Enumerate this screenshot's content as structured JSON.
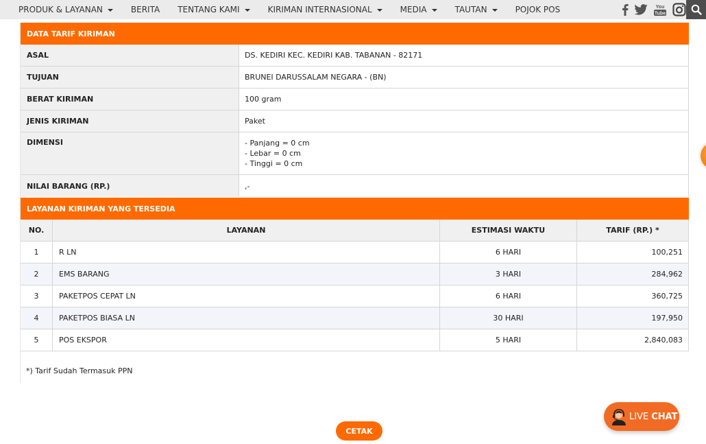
{
  "nav": {
    "items": [
      {
        "label": "PRODUK & LAYANAN",
        "dropdown": true
      },
      {
        "label": "BERITA",
        "dropdown": false
      },
      {
        "label": "TENTANG KAMI",
        "dropdown": true
      },
      {
        "label": "KIRIMAN INTERNASIONAL",
        "dropdown": true
      },
      {
        "label": "MEDIA",
        "dropdown": true
      },
      {
        "label": "TAUTAN",
        "dropdown": true
      },
      {
        "label": "POJOK POS",
        "dropdown": false
      }
    ],
    "social_icons": [
      "facebook-icon",
      "twitter-icon",
      "youtube-icon",
      "instagram-icon"
    ],
    "search_icon": "search-icon"
  },
  "tarif": {
    "title": "DATA TARIF KIRIMAN",
    "rows": {
      "asal": {
        "label": "ASAL",
        "value": "DS. KEDIRI KEC. KEDIRI KAB. TABANAN - 82171"
      },
      "tujuan": {
        "label": "TUJUAN",
        "value": "BRUNEI DARUSSALAM NEGARA - (BN)"
      },
      "berat": {
        "label": "BERAT KIRIMAN",
        "value": "100 gram"
      },
      "jenis": {
        "label": "JENIS KIRIMAN",
        "value": "Paket"
      },
      "dimensi": {
        "label": "DIMENSI",
        "lines": [
          "- Panjang = 0 cm",
          "- Lebar = 0 cm",
          "- Tinggi = 0 cm"
        ]
      },
      "nilai": {
        "label": "NILAI BARANG (RP.)",
        "value": ",-"
      }
    }
  },
  "layanan": {
    "title": "LAYANAN KIRIMAN YANG TERSEDIA",
    "headers": {
      "no": "NO.",
      "layanan": "LAYANAN",
      "estimasi": "ESTIMASI WAKTU",
      "tarif": "TARIF (RP.) *"
    },
    "rows": [
      {
        "no": "1",
        "layanan": "R LN",
        "estimasi": "6 HARI",
        "tarif": "100,251"
      },
      {
        "no": "2",
        "layanan": "EMS BARANG",
        "estimasi": "3 HARI",
        "tarif": "284,962"
      },
      {
        "no": "3",
        "layanan": "PAKETPOS CEPAT LN",
        "estimasi": "6 HARI",
        "tarif": "360,725"
      },
      {
        "no": "4",
        "layanan": "PAKETPOS BIASA LN",
        "estimasi": "30 HARI",
        "tarif": "197,950"
      },
      {
        "no": "5",
        "layanan": "POS EKSPOR",
        "estimasi": "5 HARI",
        "tarif": "2,840,083"
      }
    ]
  },
  "note": "*) Tarif Sudah Termasuk PPN",
  "buttons": {
    "cetak": "CETAK",
    "livechat_live": "LIVE",
    "livechat_chat": "CHAT"
  },
  "colors": {
    "accent": "#ff6a00",
    "livechat": "#f26b24",
    "navbar": "#ebebeb"
  }
}
